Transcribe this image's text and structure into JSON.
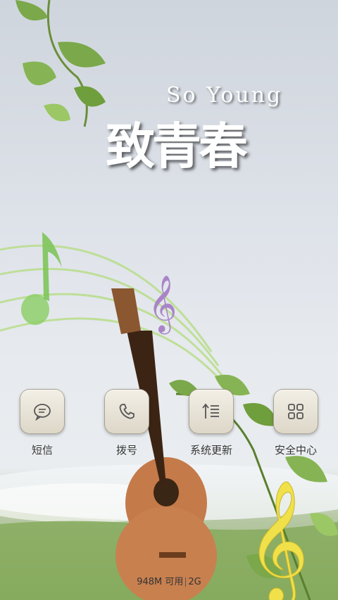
{
  "wallpaper": {
    "title_en": "So Young",
    "title_cn": "致青春"
  },
  "apps": [
    {
      "label": "短信",
      "icon": "message-icon"
    },
    {
      "label": "拨号",
      "icon": "phone-icon"
    },
    {
      "label": "系统更新",
      "icon": "system-update-icon"
    },
    {
      "label": "安全中心",
      "icon": "security-center-icon"
    }
  ],
  "status": {
    "memory": "948M 可用",
    "network": "2G"
  }
}
